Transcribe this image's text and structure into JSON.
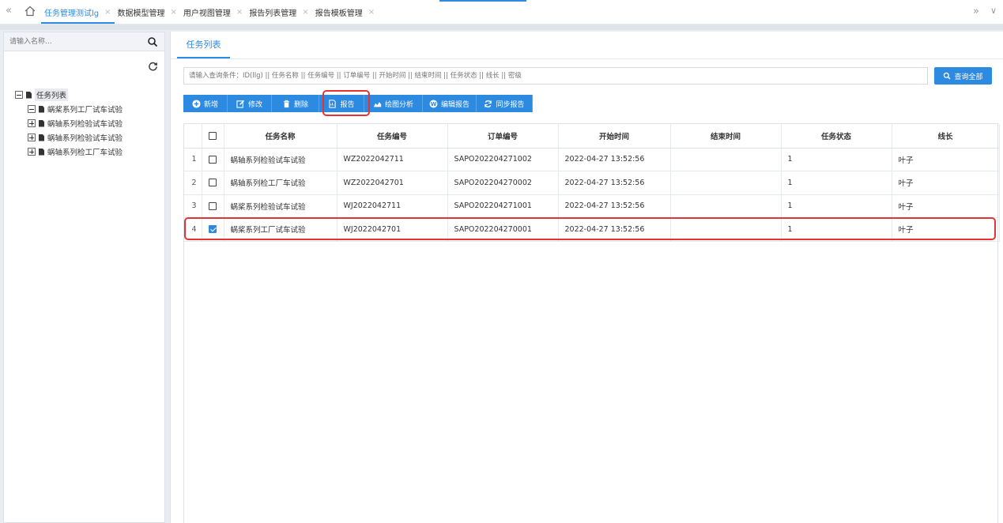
{
  "tabs": [
    {
      "label": "任务管理测试lg",
      "active": true,
      "closable": true
    },
    {
      "label": "数据模型管理",
      "active": false,
      "closable": true
    },
    {
      "label": "用户视图管理",
      "active": false,
      "closable": true
    },
    {
      "label": "报告列表管理",
      "active": false,
      "closable": true
    },
    {
      "label": "报告模板管理",
      "active": false,
      "closable": true
    }
  ],
  "nav": {
    "back_icon": "double-chevron-left-icon",
    "home_icon": "home-icon",
    "forward_icon": "double-chevron-right-icon",
    "menu_icon": "chevron-down-icon"
  },
  "sidebar": {
    "search_placeholder": "请输入名称...",
    "tree_root": "任务列表",
    "tree_items": [
      "蜗桨系列工厂试车试验",
      "蜗轴系列检验试车试验",
      "蜗轴系列检验试车试验",
      "蜗轴系列检工厂车试验"
    ]
  },
  "main": {
    "tab_label": "任务列表",
    "query_placeholder": "请输入查询条件：ID(llg) || 任务名称 || 任务编号 || 订单编号 || 开始时间 || 结束时间 || 任务状态 || 线长 || 密级",
    "query_all_label": "查询全部",
    "toolbar": [
      {
        "label": "新增",
        "icon": "plus-circle-icon",
        "width": 56
      },
      {
        "label": "修改",
        "icon": "edit-icon",
        "width": 56
      },
      {
        "label": "删除",
        "icon": "trash-icon",
        "width": 60
      },
      {
        "label": "报告",
        "icon": "report-icon",
        "width": 57
      },
      {
        "label": "绘图分析",
        "icon": "area-chart-icon",
        "width": 74
      },
      {
        "label": "编辑报告",
        "icon": "wordpress-icon",
        "width": 68
      },
      {
        "label": "同步报告",
        "icon": "sync-icon",
        "width": 71
      }
    ],
    "columns": [
      "任务名称",
      "任务编号",
      "订单编号",
      "开始时间",
      "结束时间",
      "任务状态",
      "线长"
    ],
    "rows": [
      {
        "index": "1",
        "checked": false,
        "name": "蜗轴系列检验试车试验",
        "task_no": "WZ2022042711",
        "order_no": "SAPO202204271002",
        "start": "2022-04-27 13:52:56",
        "end": "",
        "status": "1",
        "lead": "叶子"
      },
      {
        "index": "2",
        "checked": false,
        "name": "蜗轴系列检工厂车试验",
        "task_no": "WZ2022042701",
        "order_no": "SAPO202204270002",
        "start": "2022-04-27 13:52:56",
        "end": "",
        "status": "1",
        "lead": "叶子"
      },
      {
        "index": "3",
        "checked": false,
        "name": "蜗桨系列检验试车试验",
        "task_no": "WJ2022042711",
        "order_no": "SAPO202204271001",
        "start": "2022-04-27 13:52:56",
        "end": "",
        "status": "1",
        "lead": "叶子"
      },
      {
        "index": "4",
        "checked": true,
        "name": "蜗桨系列工厂试车试验",
        "task_no": "WJ2022042701",
        "order_no": "SAPO202204270001",
        "start": "2022-04-27 13:52:56",
        "end": "",
        "status": "1",
        "lead": "叶子"
      }
    ]
  },
  "colors": {
    "accent": "#2c8ae0",
    "highlight": "#e53333"
  }
}
